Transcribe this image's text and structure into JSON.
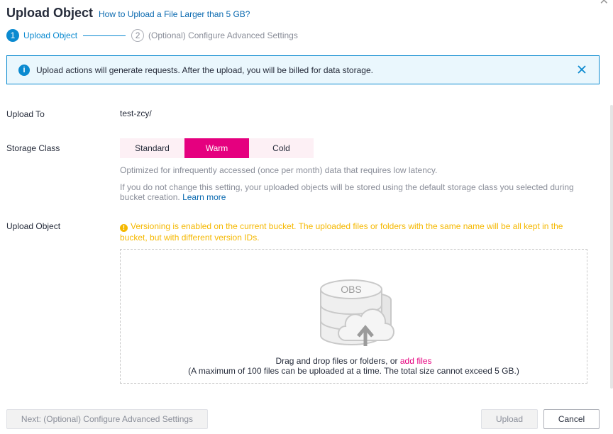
{
  "dialog": {
    "title": "Upload Object",
    "help_link": "How to Upload a File Larger than 5 GB?"
  },
  "steps": [
    {
      "number": "1",
      "label": "Upload Object",
      "active": true
    },
    {
      "number": "2",
      "label": "(Optional) Configure Advanced Settings",
      "active": false
    }
  ],
  "alert": {
    "text": "Upload actions will generate requests. After the upload, you will be billed for data storage."
  },
  "form": {
    "upload_to_label": "Upload To",
    "upload_to_value": "test-zcy/",
    "storage_class_label": "Storage Class",
    "storage_classes": [
      "Standard",
      "Warm",
      "Cold"
    ],
    "storage_class_selected": "Warm",
    "storage_hint": "Optimized for infrequently accessed (once per month) data that requires low latency.",
    "default_hint": "If you do not change this setting, your uploaded objects will be stored using the default storage class you selected during bucket creation.",
    "learn_more": "Learn more",
    "upload_object_label": "Upload Object",
    "versioning_warning": "Versioning is enabled on the current bucket. The uploaded files or folders with the same name will be all kept in the bucket, but with different version IDs."
  },
  "dropzone": {
    "obs_label": "OBS",
    "drag_text": "Drag and drop files or folders, or ",
    "add_files": "add files",
    "limit_text": "(A maximum of 100 files can be uploaded at a time. The total size cannot exceed 5 GB.)"
  },
  "buttons": {
    "next": "Next: (Optional) Configure Advanced Settings",
    "upload": "Upload",
    "cancel": "Cancel"
  },
  "colors": {
    "accent_blue": "#0b8ad0",
    "brand_pink": "#e5007f",
    "warning": "#f5b800"
  }
}
